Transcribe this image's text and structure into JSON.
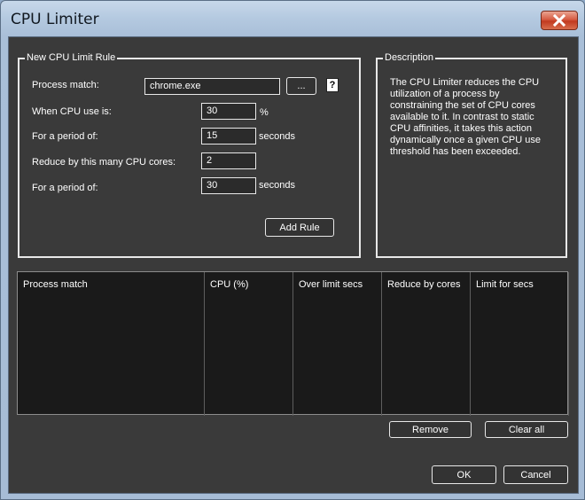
{
  "window": {
    "title": "CPU Limiter",
    "close_icon": "close-icon"
  },
  "rule_group": {
    "legend": "New CPU Limit Rule",
    "process_match_label": "Process match:",
    "process_match_value": "chrome.exe",
    "browse_label": "...",
    "help_label": "?",
    "cpu_use_label": "When CPU use is:",
    "cpu_use_value": "30",
    "cpu_use_unit": "%",
    "period1_label": "For a period of:",
    "period1_value": "15",
    "period1_unit": "seconds",
    "reduce_label": "Reduce by this many CPU cores:",
    "reduce_value": "2",
    "period2_label": "For a period of:",
    "period2_value": "30",
    "period2_unit": "seconds",
    "add_rule_label": "Add Rule"
  },
  "description": {
    "legend": "Description",
    "text": "The CPU Limiter reduces the CPU utilization of a process by constraining the set of CPU cores available to it. In contrast to static CPU affinities, it takes this action dynamically once a given CPU use threshold has been exceeded."
  },
  "rules_table": {
    "columns": [
      "Process match",
      "CPU (%)",
      "Over limit secs",
      "Reduce by cores",
      "Limit for secs"
    ],
    "rows": []
  },
  "footer": {
    "remove_label": "Remove",
    "clear_all_label": "Clear all",
    "ok_label": "OK",
    "cancel_label": "Cancel"
  }
}
